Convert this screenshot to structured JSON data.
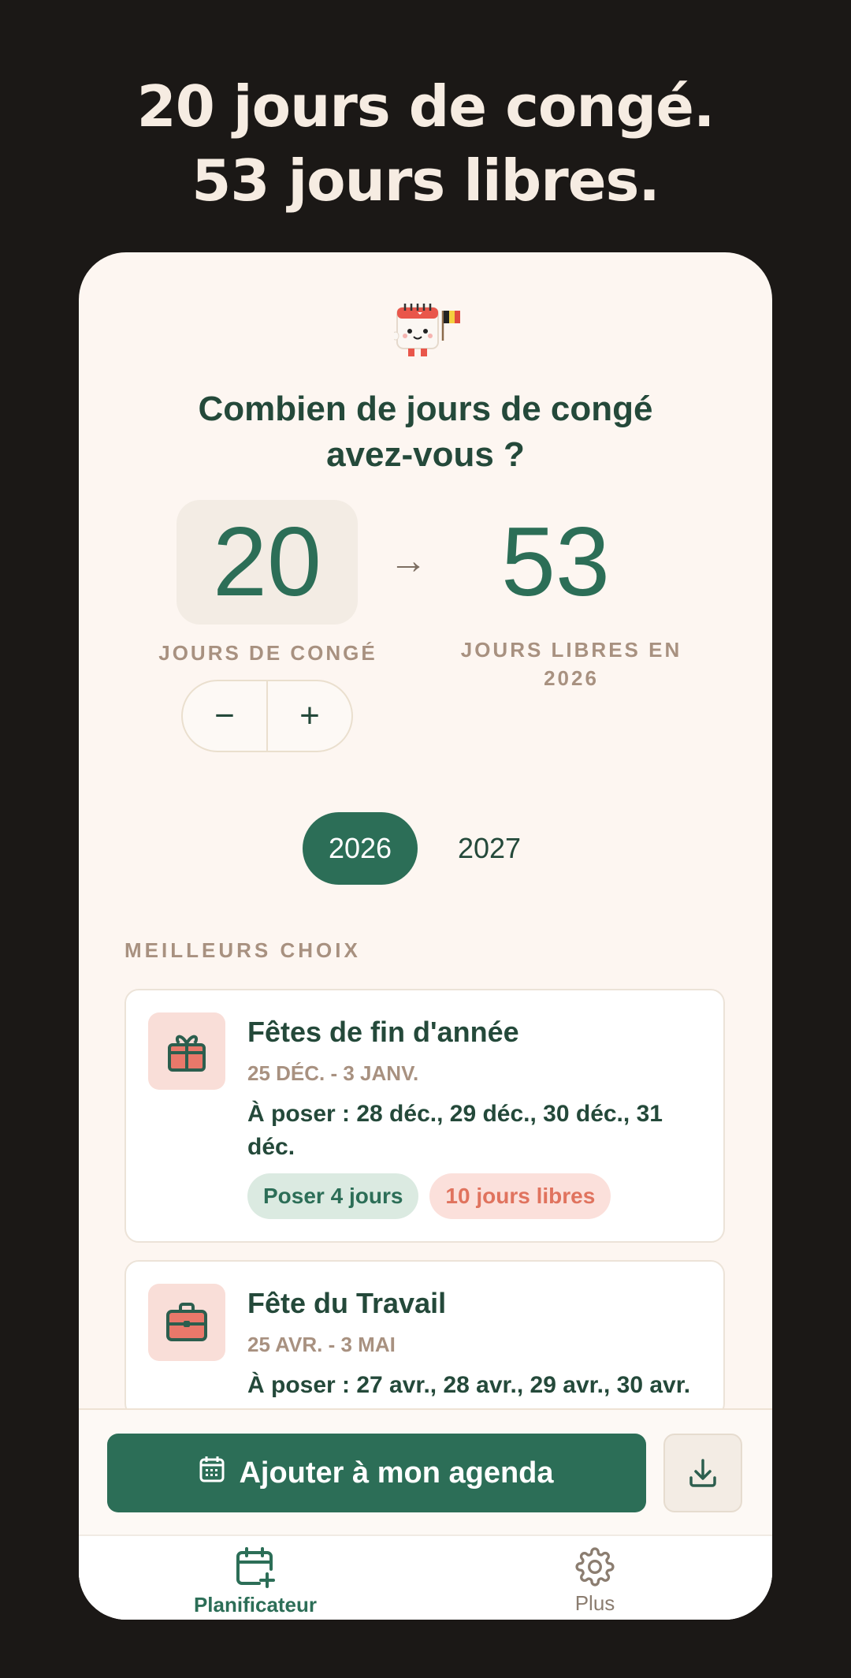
{
  "headline": {
    "line1": "20 jours de congé.",
    "line2": "53 jours libres."
  },
  "planner": {
    "question_line1": "Combien de jours de congé",
    "question_line2": "avez-vous ?",
    "leave_days": "20",
    "arrow": "→",
    "free_days": "53",
    "leave_label": "JOURS DE CONGÉ",
    "free_label_line1": "JOURS LIBRES EN",
    "free_label_line2": "2026",
    "minus": "−",
    "plus": "+"
  },
  "years": {
    "active": "2026",
    "other": "2027"
  },
  "section_title": "MEILLEURS CHOIX",
  "cards": [
    {
      "icon": "gift-icon",
      "title": "Fêtes de fin d'année",
      "dates": "25 DÉC. - 3 JANV.",
      "days": "À poser : 28 déc., 29 déc., 30 déc., 31 déc.",
      "chip_leave": "Poser 4 jours",
      "chip_free": "10 jours libres"
    },
    {
      "icon": "briefcase-icon",
      "title": "Fête du Travail",
      "dates": "25 AVR. - 3 MAI",
      "days": "À poser : 27 avr., 28 avr., 29 avr., 30 avr."
    }
  ],
  "cta_label": "Ajouter à mon agenda",
  "nav": {
    "planner": "Planificateur",
    "more": "Plus"
  },
  "colors": {
    "accent": "#2c6e57",
    "background": "#1b1816",
    "card_bg": "#fdf6f1",
    "chip_red": "#e0735e"
  }
}
